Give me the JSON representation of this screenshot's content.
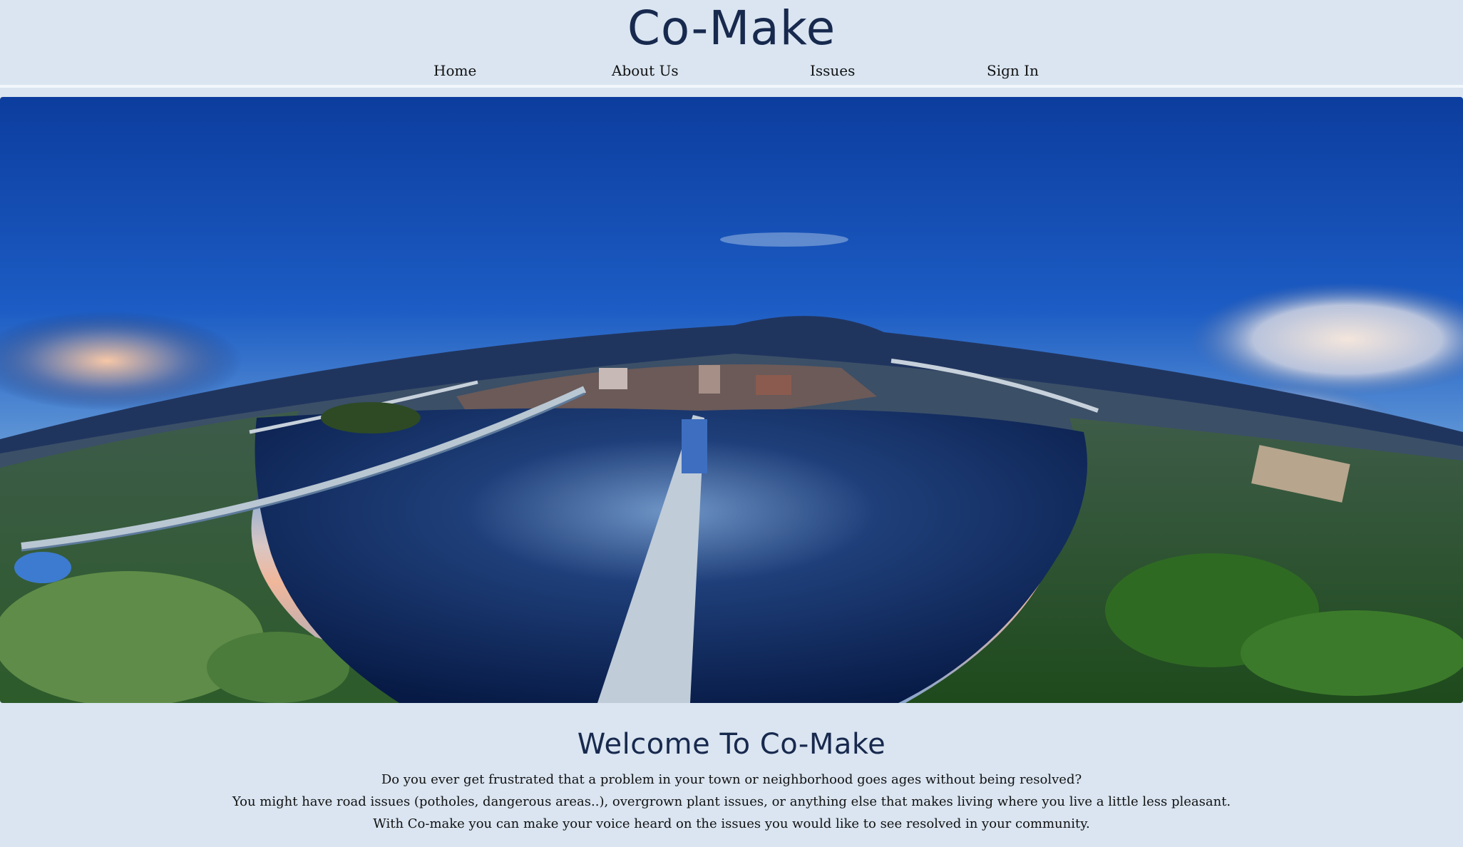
{
  "header": {
    "brand": "Co-Make",
    "nav": [
      {
        "label": "Home"
      },
      {
        "label": "About Us"
      },
      {
        "label": "Issues"
      },
      {
        "label": "Sign In"
      }
    ]
  },
  "hero": {
    "image_description_icon": "panorama-image"
  },
  "welcome": {
    "title": "Welcome To Co-Make",
    "lines": [
      "Do you ever get frustrated that a problem in your town or neighborhood goes ages without being resolved?",
      "You might have road issues (potholes, dangerous areas..), overgrown plant issues, or anything else that makes living where you live a little less pleasant.",
      "With Co-make you can make your voice heard on the issues you would like to see resolved in your community."
    ]
  },
  "colors": {
    "background": "#dae5f1",
    "brand": "#18294e",
    "text": "#111111",
    "divider": "#f2f7fc"
  }
}
